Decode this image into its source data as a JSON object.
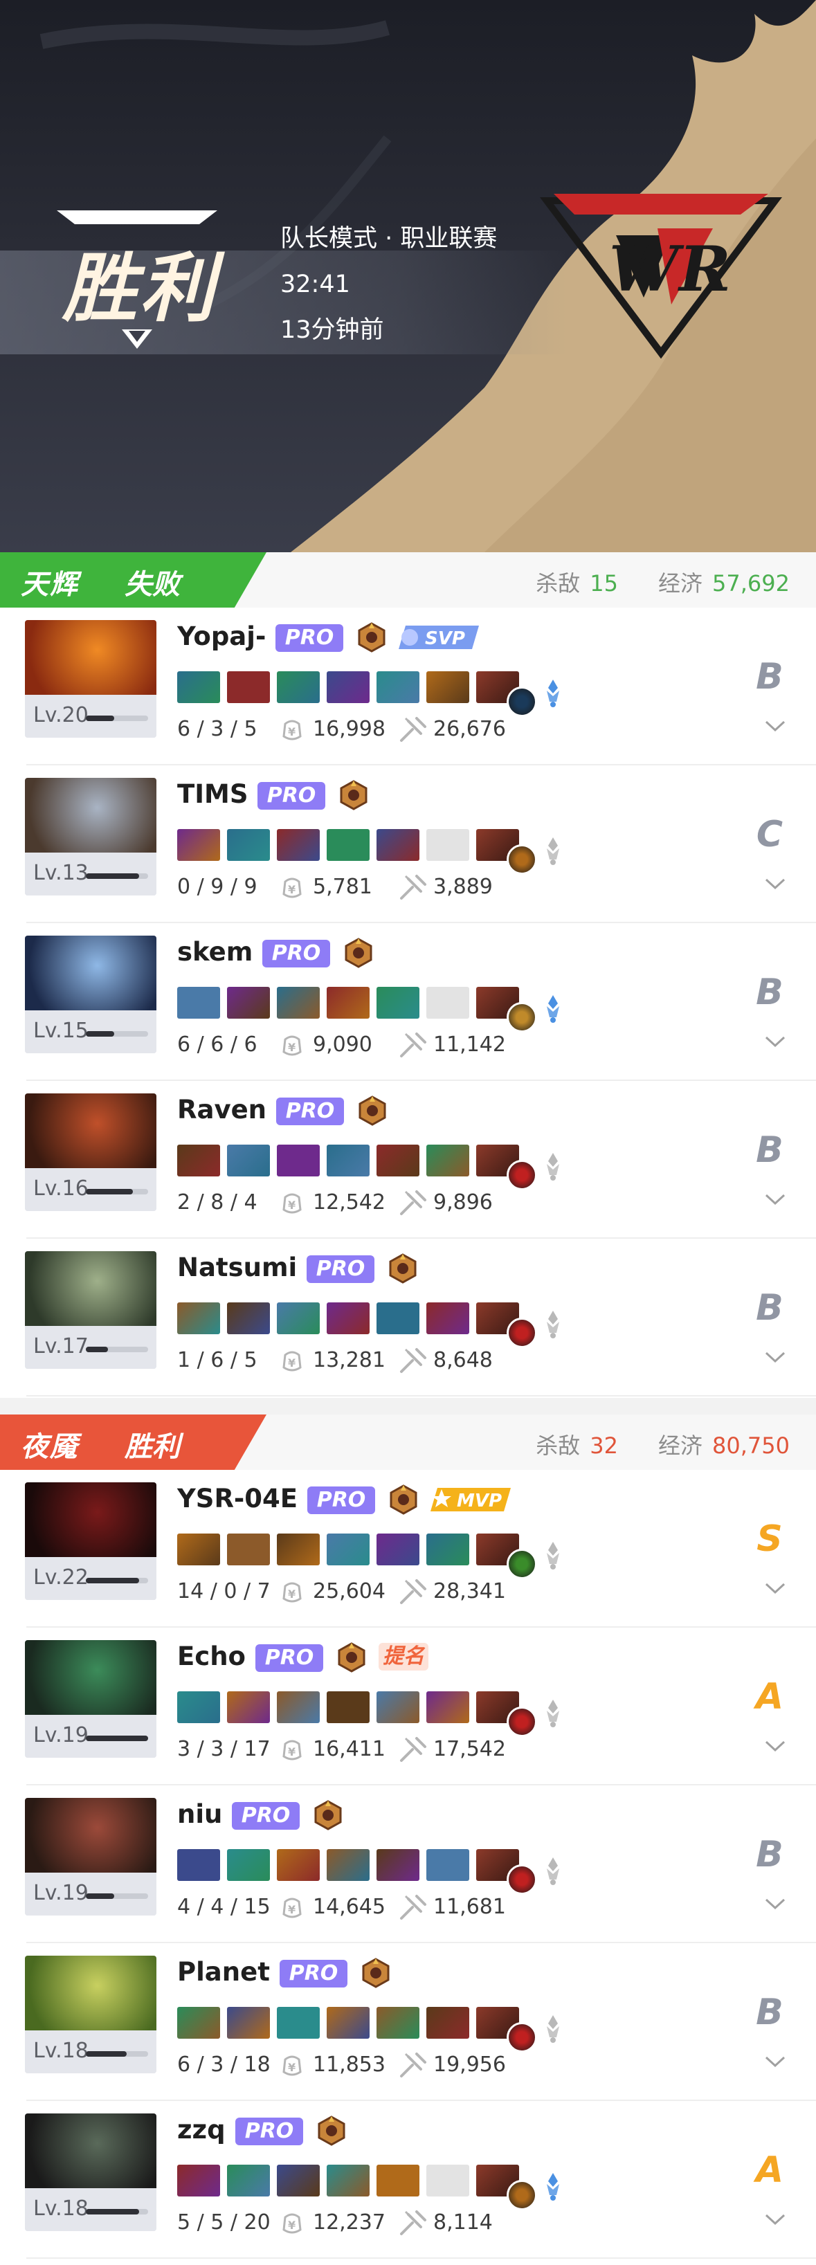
{
  "header": {
    "result": "胜利",
    "mode": "队长模式 · 职业联赛",
    "duration": "32:41",
    "time_ago": "13分钟前"
  },
  "teams": [
    {
      "name": "天辉",
      "result": "失败",
      "kills_label": "杀敌",
      "kills": "15",
      "economy_label": "经济",
      "economy": "57,692",
      "color": "#3fb43c",
      "stat_color": "#4caf50",
      "players": [
        {
          "name": "Yopaj-",
          "pro": "PRO",
          "tag": "SVP",
          "level": "Lv.20",
          "kda": "6 / 3 / 5",
          "gold": "16,998",
          "damage": "26,676",
          "grade": "B"
        },
        {
          "name": "TIMS",
          "pro": "PRO",
          "level": "Lv.13",
          "kda": "0 / 9 / 9",
          "gold": "5,781",
          "damage": "3,889",
          "grade": "C"
        },
        {
          "name": "skem",
          "pro": "PRO",
          "level": "Lv.15",
          "kda": "6 / 6 / 6",
          "gold": "9,090",
          "damage": "11,142",
          "grade": "B"
        },
        {
          "name": "Raven",
          "pro": "PRO",
          "level": "Lv.16",
          "kda": "2 / 8 / 4",
          "gold": "12,542",
          "damage": "9,896",
          "grade": "B"
        },
        {
          "name": "Natsumi",
          "pro": "PRO",
          "level": "Lv.17",
          "kda": "1 / 6 / 5",
          "gold": "13,281",
          "damage": "8,648",
          "grade": "B"
        }
      ]
    },
    {
      "name": "夜魇",
      "result": "胜利",
      "kills_label": "杀敌",
      "kills": "32",
      "economy_label": "经济",
      "economy": "80,750",
      "color": "#e8553a",
      "stat_color": "#e0553a",
      "players": [
        {
          "name": "YSR-04E",
          "pro": "PRO",
          "tag": "MVP",
          "level": "Lv.22",
          "kda": "14 / 0 / 7",
          "gold": "25,604",
          "damage": "28,341",
          "grade": "S"
        },
        {
          "name": "Echo",
          "pro": "PRO",
          "tag": "提名",
          "level": "Lv.19",
          "kda": "3 / 3 / 17",
          "gold": "16,411",
          "damage": "17,542",
          "grade": "A"
        },
        {
          "name": "niu",
          "pro": "PRO",
          "level": "Lv.19",
          "kda": "4 / 4 / 15",
          "gold": "14,645",
          "damage": "11,681",
          "grade": "B"
        },
        {
          "name": "Planet",
          "pro": "PRO",
          "level": "Lv.18",
          "kda": "6 / 3 / 18",
          "gold": "11,853",
          "damage": "19,956",
          "grade": "B"
        },
        {
          "name": "zzq",
          "pro": "PRO",
          "level": "Lv.18",
          "kda": "5 / 5 / 20",
          "gold": "12,237",
          "damage": "8,114",
          "grade": "A"
        }
      ]
    }
  ]
}
